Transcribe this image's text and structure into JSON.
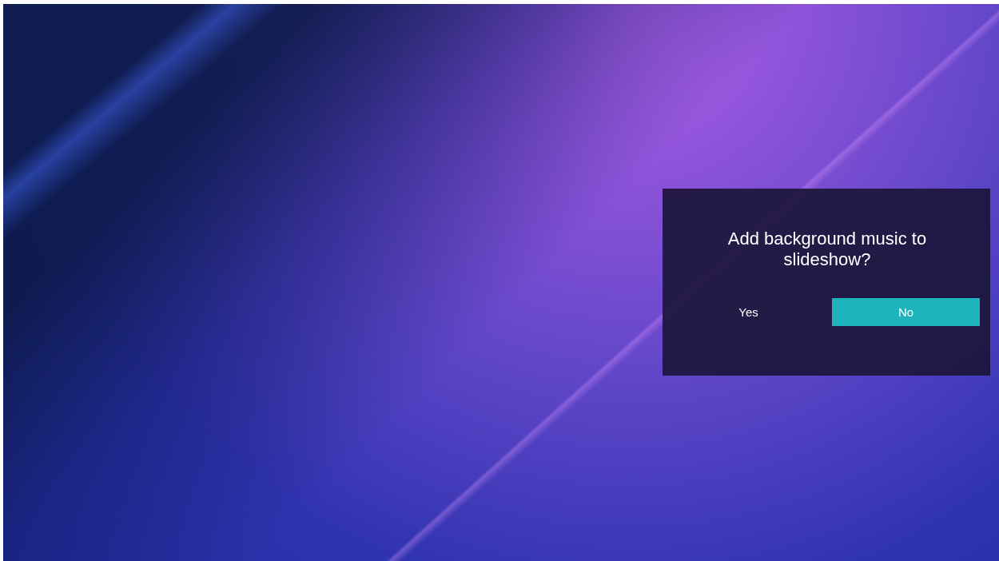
{
  "dialog": {
    "message": "Add background music to slideshow?",
    "buttons": [
      {
        "label": "Yes",
        "selected": false
      },
      {
        "label": "No",
        "selected": true
      }
    ]
  }
}
